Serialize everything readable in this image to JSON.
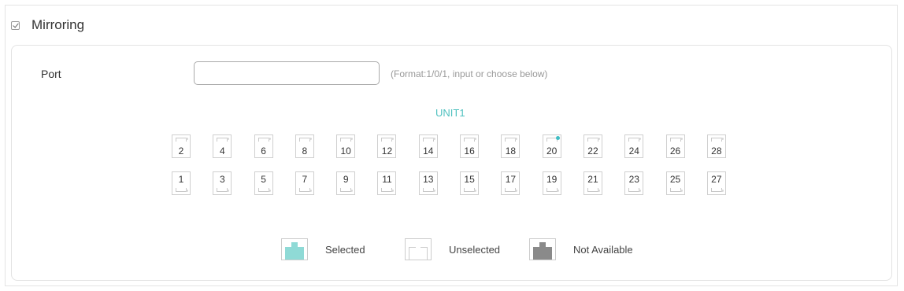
{
  "section": {
    "title": "Mirroring",
    "checked": true
  },
  "port": {
    "label": "Port",
    "value": "",
    "hint": "(Format:1/0/1, input or choose below)"
  },
  "unit": "UNIT1",
  "ports_top": [
    {
      "n": "2",
      "active": false
    },
    {
      "n": "4",
      "active": false
    },
    {
      "n": "6",
      "active": false
    },
    {
      "n": "8",
      "active": false
    },
    {
      "n": "10",
      "active": false
    },
    {
      "n": "12",
      "active": false
    },
    {
      "n": "14",
      "active": false
    },
    {
      "n": "16",
      "active": false
    },
    {
      "n": "18",
      "active": false
    },
    {
      "n": "20",
      "active": true
    },
    {
      "n": "22",
      "active": false
    },
    {
      "n": "24",
      "active": false
    },
    {
      "n": "26",
      "active": false
    },
    {
      "n": "28",
      "active": false
    }
  ],
  "ports_bottom": [
    {
      "n": "1",
      "active": false
    },
    {
      "n": "3",
      "active": false
    },
    {
      "n": "5",
      "active": false
    },
    {
      "n": "7",
      "active": false
    },
    {
      "n": "9",
      "active": false
    },
    {
      "n": "11",
      "active": false
    },
    {
      "n": "13",
      "active": false
    },
    {
      "n": "15",
      "active": false
    },
    {
      "n": "17",
      "active": false
    },
    {
      "n": "19",
      "active": false
    },
    {
      "n": "21",
      "active": false
    },
    {
      "n": "23",
      "active": false
    },
    {
      "n": "25",
      "active": false
    },
    {
      "n": "27",
      "active": false
    }
  ],
  "legend": {
    "selected": "Selected",
    "unselected": "Unselected",
    "not_available": "Not Available"
  },
  "colors": {
    "accent": "#4fc1bf",
    "selected": "#8fdad6",
    "not_available": "#8a8a8a",
    "link_led": "#3fbdc4"
  }
}
